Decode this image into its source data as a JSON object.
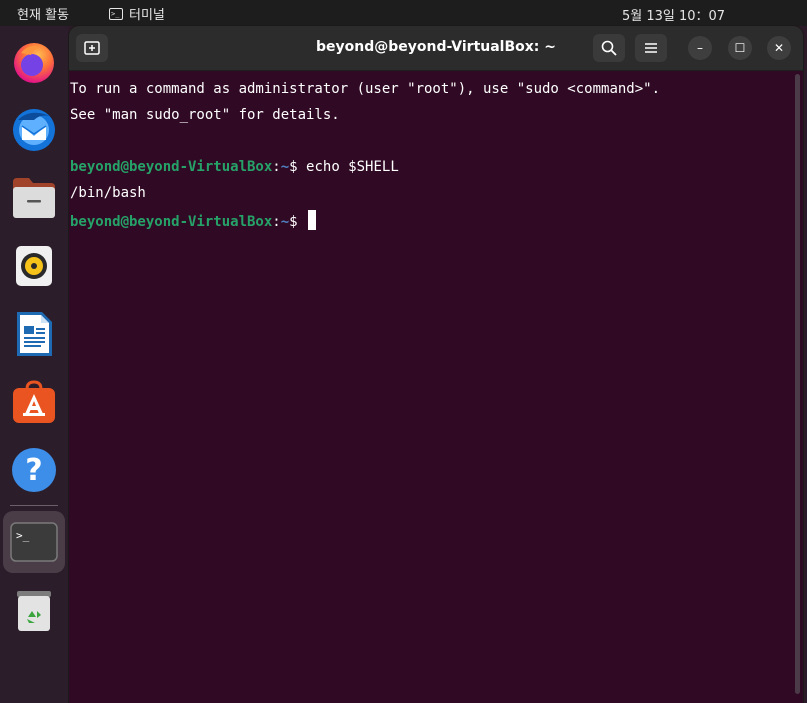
{
  "topbar": {
    "activities": "현재 활동",
    "app_name": "터미널",
    "clock": "5월 13일  10：07"
  },
  "dock": {
    "items": [
      {
        "name": "firefox",
        "icon": "firefox-icon"
      },
      {
        "name": "thunderbird",
        "icon": "thunderbird-icon"
      },
      {
        "name": "files",
        "icon": "files-icon"
      },
      {
        "name": "rhythmbox",
        "icon": "rhythmbox-icon"
      },
      {
        "name": "libreoffice-writer",
        "icon": "writer-icon"
      },
      {
        "name": "app-center",
        "icon": "app-center-icon"
      },
      {
        "name": "help",
        "icon": "help-icon"
      },
      {
        "name": "terminal",
        "icon": "terminal-icon",
        "active": true
      },
      {
        "name": "trash",
        "icon": "trash-icon"
      }
    ],
    "terminal_icon_text": ">_",
    "help_glyph": "?"
  },
  "window": {
    "title": "beyond@beyond-VirtualBox: ~",
    "close_glyph": "✕",
    "minimize_glyph": "–",
    "maximize_glyph": "☐"
  },
  "terminal": {
    "line1": "To run a command as administrator (user \"root\"), use \"sudo <command>\".",
    "line2": "See \"man sudo_root\" for details.",
    "prompt_user": "beyond@beyond-VirtualBox",
    "prompt_sep": ":",
    "prompt_path": "~",
    "prompt_dollar": "$ ",
    "command1": "echo $SHELL",
    "output1": "/bin/bash"
  },
  "colors": {
    "terminal_bg": "#300a24",
    "prompt_user": "#26a269",
    "prompt_path": "#5080c0",
    "accent": "#e95420"
  }
}
